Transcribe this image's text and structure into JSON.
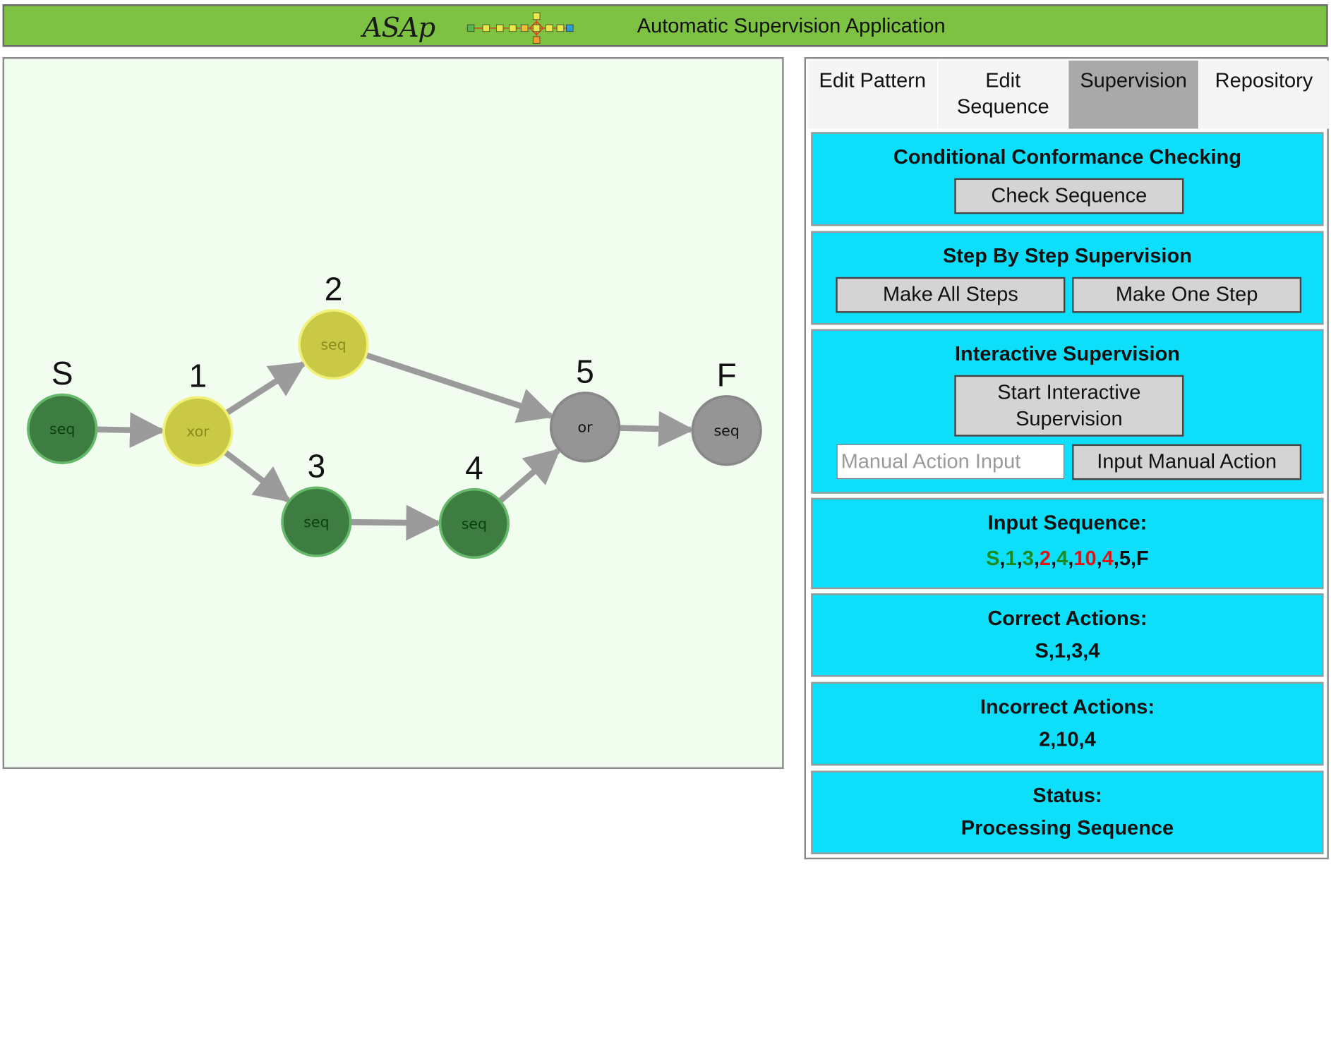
{
  "header": {
    "logo_text": "ASAp",
    "title": "Automatic Supervision Application",
    "background_color": "#7dc242"
  },
  "graph": {
    "nodes": [
      {
        "id": "S",
        "label": "S",
        "kind": "seq",
        "state": "correct",
        "color": "#3d7d41"
      },
      {
        "id": "1",
        "label": "1",
        "kind": "xor",
        "state": "current",
        "color": "#c9c946"
      },
      {
        "id": "2",
        "label": "2",
        "kind": "seq",
        "state": "current",
        "color": "#c9c946"
      },
      {
        "id": "3",
        "label": "3",
        "kind": "seq",
        "state": "correct",
        "color": "#3d7d41"
      },
      {
        "id": "4",
        "label": "4",
        "kind": "seq",
        "state": "correct",
        "color": "#3d7d41"
      },
      {
        "id": "5",
        "label": "5",
        "kind": "or",
        "state": "pending",
        "color": "#959595"
      },
      {
        "id": "F",
        "label": "F",
        "kind": "seq",
        "state": "pending",
        "color": "#959595"
      }
    ],
    "edges": [
      {
        "from": "S",
        "to": "1"
      },
      {
        "from": "1",
        "to": "2"
      },
      {
        "from": "1",
        "to": "3"
      },
      {
        "from": "3",
        "to": "4"
      },
      {
        "from": "2",
        "to": "5"
      },
      {
        "from": "4",
        "to": "5"
      },
      {
        "from": "5",
        "to": "F"
      }
    ]
  },
  "tabs": [
    {
      "label": "Edit Pattern",
      "active": false
    },
    {
      "label": "Edit Sequence",
      "active": false
    },
    {
      "label": "Supervision",
      "active": true
    },
    {
      "label": "Repository",
      "active": false
    }
  ],
  "conformance": {
    "title": "Conditional Conformance Checking",
    "check_button": "Check Sequence"
  },
  "step_by_step": {
    "title": "Step By Step Supervision",
    "all_steps_button": "Make All Steps",
    "one_step_button": "Make One Step"
  },
  "interactive": {
    "title": "Interactive Supervision",
    "start_button": "Start Interactive Supervision",
    "manual_input_placeholder": "Manual Action Input",
    "manual_input_value": "",
    "input_button": "Input Manual Action"
  },
  "input_sequence": {
    "title": "Input Sequence:",
    "items": [
      {
        "value": "S",
        "state": "ok"
      },
      {
        "value": "1",
        "state": "ok"
      },
      {
        "value": "3",
        "state": "ok"
      },
      {
        "value": "2",
        "state": "bad"
      },
      {
        "value": "4",
        "state": "ok"
      },
      {
        "value": "10",
        "state": "bad"
      },
      {
        "value": "4",
        "state": "bad"
      },
      {
        "value": "5",
        "state": "pend"
      },
      {
        "value": "F",
        "state": "pend"
      }
    ],
    "ok_color": "#1e8a1e",
    "bad_color": "#e01414"
  },
  "correct_actions": {
    "title": "Correct Actions:",
    "value": "S,1,3,4"
  },
  "incorrect_actions": {
    "title": "Incorrect Actions:",
    "value": "2,10,4"
  },
  "status": {
    "title": "Status:",
    "value": "Processing Sequence"
  },
  "panel_accent_color": "#0ddffb"
}
